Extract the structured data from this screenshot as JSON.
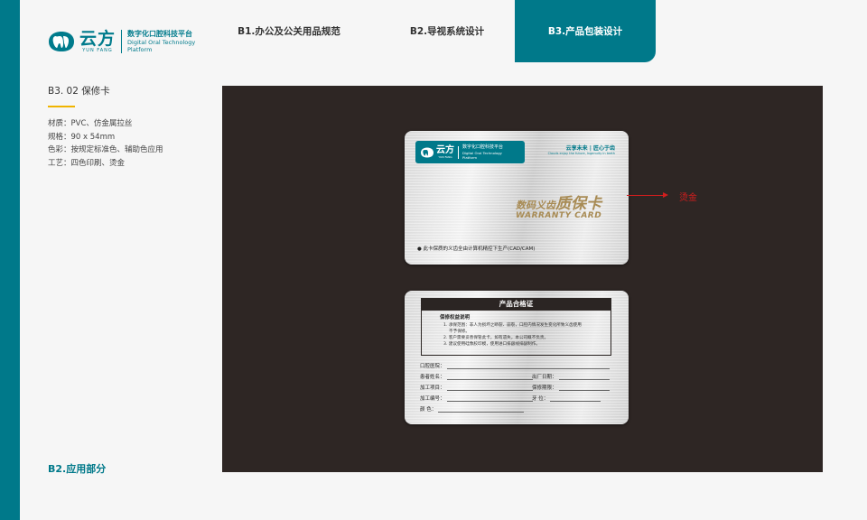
{
  "brand": {
    "name_cn": "云方",
    "name_en": "YUN FANG",
    "tagline_cn": "数字化口腔科技平台",
    "tagline_en_1": "Digital Oral Technology",
    "tagline_en_2": "Platform"
  },
  "nav": [
    {
      "label": "B1.办公及公关用品规范",
      "active": false
    },
    {
      "label": "B2.导视系统设计",
      "active": false
    },
    {
      "label": "B3.产品包装设计",
      "active": true
    }
  ],
  "section": {
    "title": "B3. 02  保修卡",
    "specs": [
      "材质：PVC、仿金属拉丝",
      "规格：90 x 54mm",
      "色彩：按规定标准色、辅助色应用",
      "工艺：四色印刷、烫金"
    ]
  },
  "footer_label": "B2.应用部分",
  "card_front": {
    "slogan_cn": "云享未来 | 匠心于齿",
    "slogan_en": "Clouds enjoy the future, Ingenuity in teeth",
    "warranty_small": "数码义齿",
    "warranty_big": "质保卡",
    "warranty_en": "WARRANTY CARD",
    "note": "● 此卡保质的义齿全由计算机精控下生产(CAD/CAM)"
  },
  "annotation": {
    "label": "烫金",
    "color": "#d21e1e"
  },
  "card_back": {
    "header": "产品合格证",
    "box_title": "保修权益说明",
    "box_lines": [
      "1. 承保范围：非人为损坏之断裂、崩裂，口腔内情况发生变化所致义齿使用",
      "不予保修。",
      "2. 客户需要妥善保管此卡，如有遗失，本公司概不负责。",
      "3. 建议使用硅像胶印模，使用进口排龈线排龈制作。"
    ],
    "fields": {
      "clinic": "口腔医院：",
      "patient": "患者姓名：",
      "factory_date": "出厂日期：",
      "project": "加工项目：",
      "warranty_period": "保修期限：",
      "serial": "加工编号：",
      "tooth": "牙      位：",
      "color": "颜      色："
    }
  },
  "colors": {
    "brand": "#00798a",
    "accent": "#f0b400",
    "display_bg": "#2e2624",
    "gold": "#a88b54"
  }
}
